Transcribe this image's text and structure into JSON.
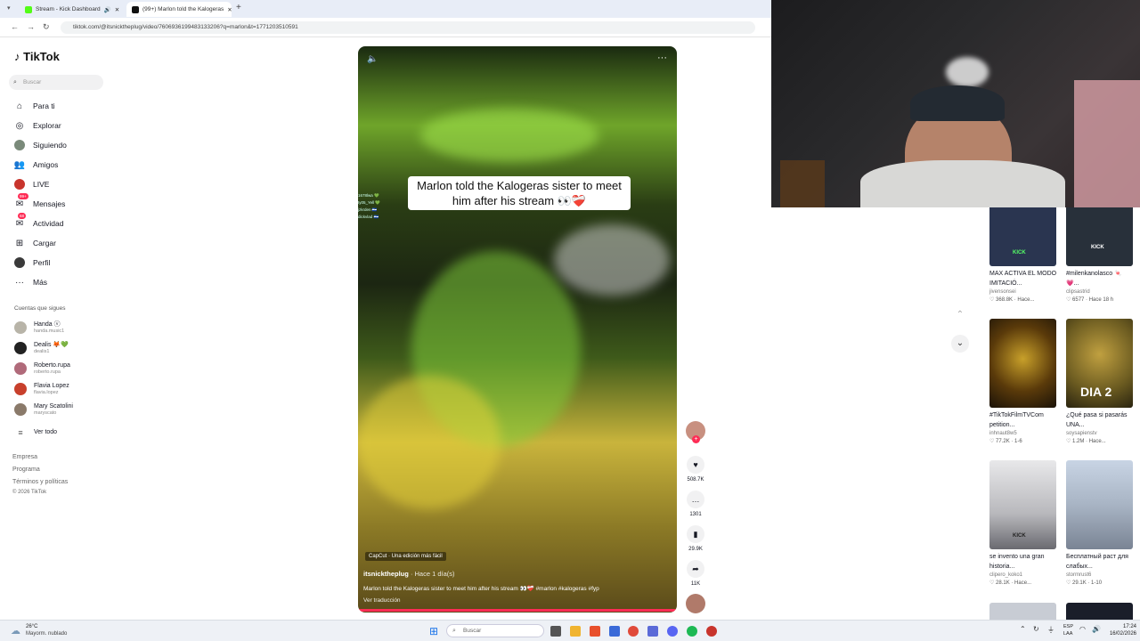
{
  "browser": {
    "tabs": [
      {
        "title": "Stream - Kick Dashboard"
      },
      {
        "title": "(99+) Marlon told the Kalogeras"
      }
    ],
    "new_tab": "+",
    "url": "tiktok.com/@itsnicktheplug/video/7606936199483133206?q=marlon&t=1771203510591"
  },
  "sidebar": {
    "logo": "TikTok",
    "search_placeholder": "Buscar",
    "nav": [
      {
        "label": "Para ti",
        "icon": "home-icon"
      },
      {
        "label": "Explorar",
        "icon": "compass-icon"
      },
      {
        "label": "Siguiendo",
        "icon": "following-avatar-icon"
      },
      {
        "label": "Amigos",
        "icon": "friends-icon"
      },
      {
        "label": "LIVE",
        "icon": "live-icon"
      },
      {
        "label": "Mensajes",
        "icon": "message-icon",
        "badge": "99+"
      },
      {
        "label": "Actividad",
        "icon": "inbox-icon",
        "badge": "68"
      },
      {
        "label": "Cargar",
        "icon": "upload-icon"
      },
      {
        "label": "Perfil",
        "icon": "profile-icon"
      },
      {
        "label": "Más",
        "icon": "more-icon"
      }
    ],
    "following_title": "Cuentas que sigues",
    "following": [
      {
        "name": "Handa ⓥ",
        "handle": "handa.music1"
      },
      {
        "name": "Dealis 🦊💚",
        "handle": "dealis1"
      },
      {
        "name": "Roberto.rupa",
        "handle": "roberto.rupa"
      },
      {
        "name": "Flavia Lopez",
        "handle": "flavia.lopez"
      },
      {
        "name": "Mary Scatolini",
        "handle": "maryscato"
      }
    ],
    "see_all": "Ver todo",
    "footer": [
      "Empresa",
      "Programa",
      "Términos y políticas",
      "© 2026 TikTok"
    ]
  },
  "video": {
    "caption_overlay": "Marlon told the Kalogeras sister to meet him after his stream 👀❤️‍🩹",
    "capcut": "CapCut · Una edición más fácil",
    "author": "itsnicktheplug",
    "posted": "· Hace 1 día(s)",
    "description": "Marlon told the Kalogeras sister to meet him after his stream 👀❤️‍🩹 #marlon #kalogeras #fyp",
    "translate": "Ver traducción",
    "chat": [
      "1678lwa 💚",
      "ty05_Yell 💚",
      "jzkrden 🇸🇻",
      "dickvlad 🇸🇻"
    ]
  },
  "actions": {
    "likes": "508.7K",
    "comments": "1301",
    "saves": "29.9K",
    "shares": "11K"
  },
  "recommendations": [
    {
      "title": "MAX ACTIVA EL MODO IMITACIÓ...",
      "user": "jivensonsei",
      "meta": "♡ 368.8K · Hace...",
      "color": "#2a3550"
    },
    {
      "title": "#milenkanolasco 🍬💗...",
      "user": "clipsastrid",
      "meta": "♡ 6577 · Hace 18 h",
      "color": "#28303a"
    },
    {
      "title": "#TikTokFilmTVCom petition...",
      "user": "inhnaut8w5",
      "meta": "♡ 77.2K · 1-6",
      "color": "#3a2a0a"
    },
    {
      "title": "¿Qué pasa si pasarás UNA...",
      "user": "soysapienstv",
      "meta": "♡ 1.2M · Hace...",
      "color": "#6a5a20"
    },
    {
      "title": "se invento una gran historia...",
      "user": "clipero_koko1",
      "meta": "♡ 28.1K · Hace...",
      "color": "#c8c8cc"
    },
    {
      "title": "Бесплатный раст для слабых...",
      "user": "stormrust6",
      "meta": "♡ 29.1K · 1-10",
      "color": "#a8b4c4"
    }
  ],
  "rec_overlays": [
    "KICK",
    "KICK",
    "DIA 2",
    "KICK"
  ],
  "taskbar": {
    "weather_temp": "26°C",
    "weather_desc": "Mayorm. nublado",
    "search": "Buscar",
    "lang": "ESP",
    "lang2": "LAA",
    "time": "17:24",
    "date": "16/02/2026"
  }
}
